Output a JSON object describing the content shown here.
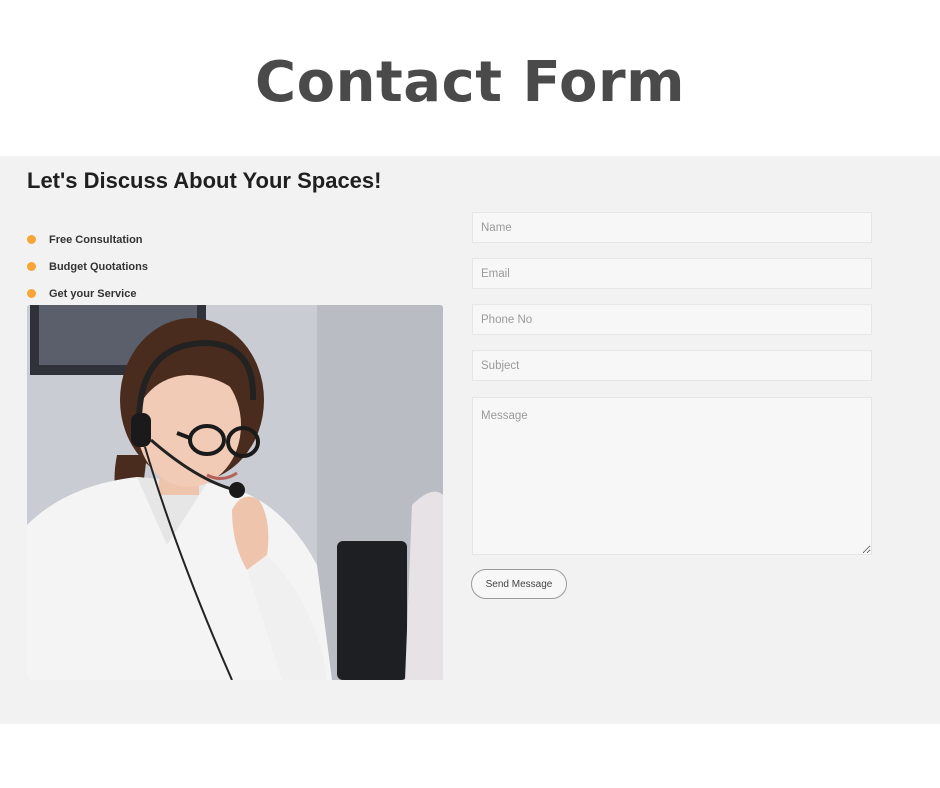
{
  "page": {
    "title": "Contact Form"
  },
  "section": {
    "heading": "Let's Discuss About Your Spaces!",
    "features": [
      {
        "label": "Free Consultation"
      },
      {
        "label": "Budget Quotations"
      },
      {
        "label": "Get your Service"
      }
    ],
    "bullet_color": "#f7a535",
    "image_alt": "Smiling woman wearing a headset and glasses at a desk"
  },
  "form": {
    "name_placeholder": "Name",
    "email_placeholder": "Email",
    "phone_placeholder": "Phone No",
    "subject_placeholder": "Subject",
    "message_placeholder": "Message",
    "submit_label": "Send Message"
  }
}
